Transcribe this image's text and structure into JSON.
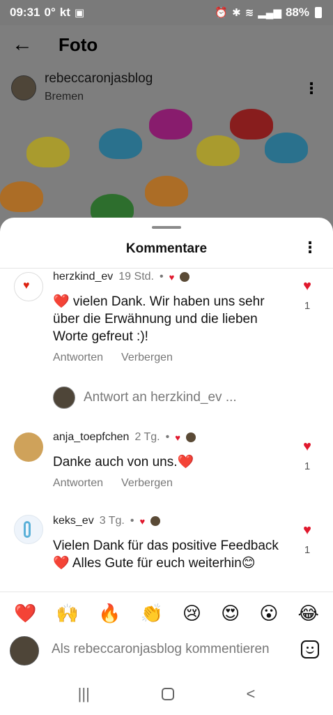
{
  "status_bar": {
    "time": "09:31",
    "temperature": "0°",
    "carrier": "kt",
    "battery": "88%"
  },
  "app_bar": {
    "title": "Foto"
  },
  "post": {
    "username": "rebeccaronjasblog",
    "location": "Bremen"
  },
  "sheet": {
    "title": "Kommentare"
  },
  "comments": [
    {
      "username": "herzkind_ev",
      "time": "19 Std.",
      "text": "❤️ vielen Dank. Wir haben uns sehr über die Erwähnung und die lieben Worte gefreut :)!",
      "likes": "1",
      "reply_label": "Antworten",
      "hide_label": "Verbergen"
    },
    {
      "username": "anja_toepfchen",
      "time": "2 Tg.",
      "text": "Danke auch von uns.❤️",
      "likes": "1",
      "reply_label": "Antworten",
      "hide_label": "Verbergen"
    },
    {
      "username": "keks_ev",
      "time": "3 Tg.",
      "text": "Vielen Dank für das positive Feedback❤️ Alles Gute für euch weiterhin😊",
      "likes": "1"
    }
  ],
  "reply_prompt": "Antwort an herzkind_ev ...",
  "emoji_bar": [
    "❤️",
    "🙌",
    "🔥",
    "👏",
    "😢",
    "😍",
    "😮",
    "😂"
  ],
  "comment_input": {
    "placeholder": "Als rebeccaronjasblog kommentieren"
  },
  "icons": {
    "back": "arrow-left-icon",
    "more": "more-vertical-icon",
    "like": "heart-icon",
    "sticker": "sticker-icon"
  },
  "colors": {
    "like": "#e0182d",
    "muted_text": "#777777"
  }
}
